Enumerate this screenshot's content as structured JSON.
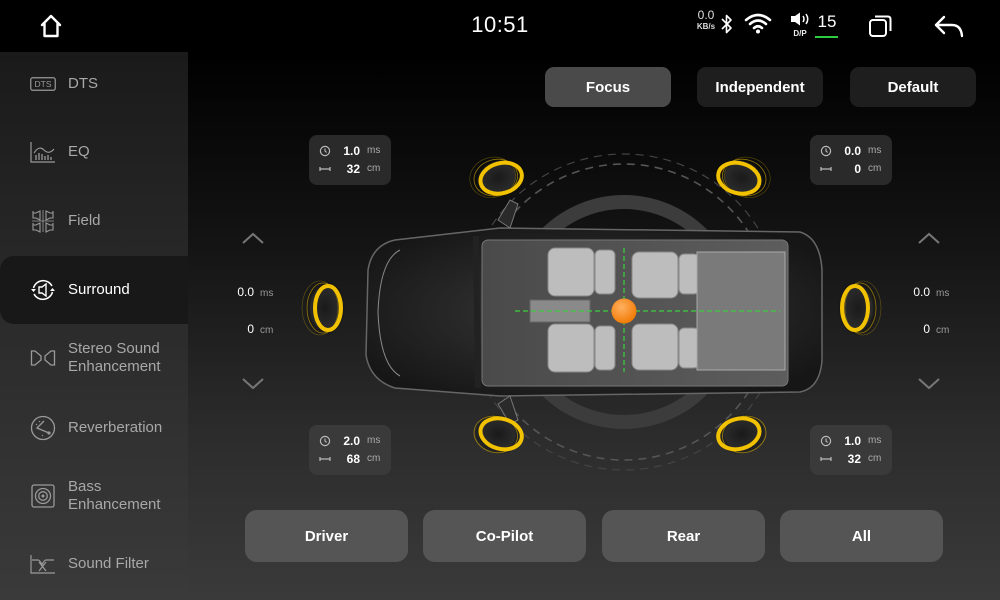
{
  "statusbar": {
    "clock": "10:51",
    "net_speed_value": "0.0",
    "net_speed_unit": "KB/s",
    "volume_mode": "D/P",
    "volume_level": "15",
    "volume_bar_color": "#2ecc40",
    "icons": [
      "home-icon",
      "bluetooth-icon",
      "wifi-icon",
      "speaker-icon",
      "windows-icon",
      "back-icon"
    ]
  },
  "sidebar": {
    "active_index": 3,
    "items": [
      {
        "label": "DTS",
        "icon": "dts-icon",
        "icon_text": "DTS"
      },
      {
        "label": "EQ",
        "icon": "eq-icon"
      },
      {
        "label": "Field",
        "icon": "field-icon"
      },
      {
        "label": "Surround",
        "icon": "surround-icon"
      },
      {
        "label": "Stereo Sound Enhancement",
        "line1": "Stereo Sound",
        "line2": "Enhancement",
        "icon": "stereo-icon"
      },
      {
        "label": "Reverberation",
        "icon": "reverb-icon"
      },
      {
        "label": "Bass Enhancement",
        "line1": "Bass",
        "line2": "Enhancement",
        "icon": "bass-icon"
      },
      {
        "label": "Sound Filter",
        "icon": "filter-icon"
      }
    ]
  },
  "modes": {
    "active": "Focus",
    "items": [
      {
        "label": "Focus"
      },
      {
        "label": "Independent"
      },
      {
        "label": "Default"
      }
    ]
  },
  "speakers": {
    "front_left": {
      "delay": "1.0",
      "delay_unit": "ms",
      "distance": "32",
      "distance_unit": "cm"
    },
    "front_right": {
      "delay": "0.0",
      "delay_unit": "ms",
      "distance": "0",
      "distance_unit": "cm"
    },
    "rear_left": {
      "delay": "2.0",
      "delay_unit": "ms",
      "distance": "68",
      "distance_unit": "cm"
    },
    "rear_right": {
      "delay": "1.0",
      "delay_unit": "ms",
      "distance": "32",
      "distance_unit": "cm"
    },
    "left_center": {
      "delay": "0.0",
      "delay_unit": "ms",
      "distance": "0",
      "distance_unit": "cm"
    },
    "right_center": {
      "delay": "0.0",
      "delay_unit": "ms",
      "distance": "0",
      "distance_unit": "cm"
    }
  },
  "colors": {
    "speaker_ring": "#f2c200",
    "focus_point": "#ff8a1e",
    "crosshair": "#3ad13a"
  },
  "zones": {
    "items": [
      {
        "label": "Driver"
      },
      {
        "label": "Co-Pilot"
      },
      {
        "label": "Rear"
      },
      {
        "label": "All"
      }
    ]
  }
}
